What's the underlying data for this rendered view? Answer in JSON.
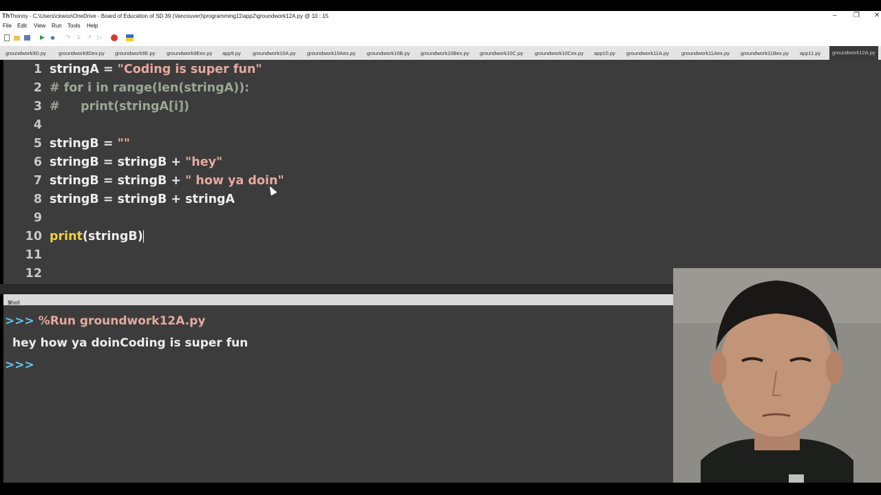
{
  "window": {
    "title": "Thonny  -  C:\\Users\\ckwoo\\OneDrive - Board of Education of SD 39 (Vancouver)\\programming11\\app2\\groundwork12A.py  @  10 : 15",
    "app_icon": "Th"
  },
  "menu": [
    "File",
    "Edit",
    "View",
    "Run",
    "Tools",
    "Help"
  ],
  "tabs": [
    "groundwork9D.py",
    "groundwork9Dex.py",
    "groundwork9E.py",
    "groundwork9Eex.py",
    "app9.py",
    "groundwork10A.py",
    "groundwork10Aex.py",
    "groundwork10B.py",
    "groundwork10Bex.py",
    "groundwork10C.py",
    "groundwork10Cex.py",
    "app10.py",
    "groundwork11A.py",
    "groundwork11Aex.py",
    "groundwork11Bex.py",
    "app11.py",
    "groundwork12A.py"
  ],
  "editor": {
    "line_numbers": [
      "1",
      "2",
      "3",
      "4",
      "5",
      "6",
      "7",
      "8",
      "9",
      "10",
      "11",
      "12"
    ],
    "lines": [
      {
        "a": "stringA = ",
        "s": "\"Coding is super fun\""
      },
      {
        "c": "# for i in range(len(stringA)):"
      },
      {
        "c": "#     print(stringA[i])"
      },
      {},
      {
        "a": "stringB = ",
        "s": "\"\""
      },
      {
        "a": "stringB = stringB + ",
        "s": "\"hey\""
      },
      {
        "a": "stringB = stringB + ",
        "s": "\" how ya doin\""
      },
      {
        "a": "stringB = stringB + stringA"
      },
      {},
      {
        "k": "print",
        "a": "(stringB)"
      },
      {},
      {}
    ]
  },
  "shell": {
    "tab_label": "Shell",
    "prompt": ">>>",
    "run_cmd": "%Run groundwork12A.py",
    "output": "hey how ya doinCoding is super fun"
  }
}
